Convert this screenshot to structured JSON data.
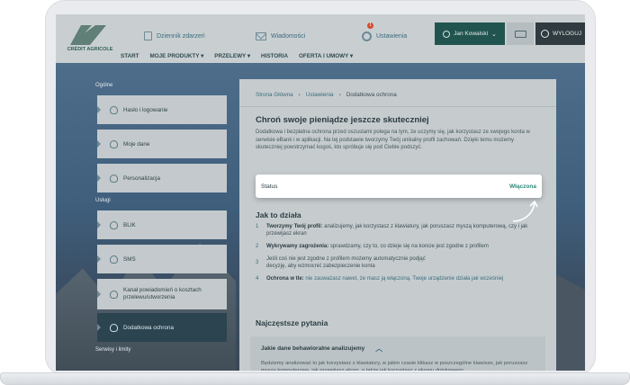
{
  "header": {
    "logo_text": "CRÉDIT AGRICOLE",
    "links": {
      "history": "Dziennik zdarzeń",
      "messages": "Wiadomości",
      "settings": "Ustawienia"
    },
    "notification_count": "1",
    "user_name": "Jan Kowalski",
    "logout_label": "WYLOGUJ",
    "nav": [
      "START",
      "MOJE PRODUKTY ▾",
      "PRZELEWY ▾",
      "HISTORIA",
      "OFERTA I UMOWY ▾"
    ]
  },
  "sidebar": {
    "section_general": "Ogólne",
    "section_services": "Usługi",
    "section_other": "Serwisy i limity",
    "items": [
      {
        "label": "Hasło i logowanie"
      },
      {
        "label": "Moje dane"
      },
      {
        "label": "Personalizacja"
      },
      {
        "label": "BLIK"
      },
      {
        "label": "SMS"
      },
      {
        "label": "Kanał powiadomień o kosztach przelewu/utworzenia"
      },
      {
        "label": "Dodatkowa ochrona"
      }
    ]
  },
  "main": {
    "breadcrumb": [
      "Strona Główna",
      "Ustawienia",
      "Dodatkowa ochrona"
    ],
    "title": "Chroń swoje pieniądze jeszcze skuteczniej",
    "lead": "Dodatkowa i bezpłatna ochrona przed oszustami polega na tym, że uczymy się, jak korzystasz ze swojego konta w serwisie eBank i w aplikacji. Na tej podstawie tworzymy Twój unikalny profil zachowań. Dzięki temu możemy skuteczniej powstrzymać kogoś, kto spróbuje się pod Ciebie podszyć.",
    "status_label": "Status",
    "status_value": "Włączona",
    "how_title": "Jak to działa",
    "steps": [
      {
        "num": "1",
        "bold": "Tworzymy Twój profil:",
        "text": " analizujemy, jak korzystasz z klawiatury, jak poruszasz myszą komputerową, czy i jak przewijasz ekran"
      },
      {
        "num": "2",
        "bold": "Wykrywamy zagrożenia:",
        "text": " sprawdzamy, czy to, co dzieje się na koncie jest zgodne z profilem"
      },
      {
        "num": "3",
        "bold": "",
        "text": "Jeśli coś nie jest zgodne z profilem możemy automatycznie podjąć decyzję, aby wzmocnić zabezpieczenie konta"
      },
      {
        "num": "4",
        "bold": "Ochrona w tle:",
        "text": " nie zauważasz nawet, że masz ją włączoną. Twoje urządzenie działa jak wcześniej"
      }
    ],
    "faq_title": "Najczęstsze pytania",
    "faq_question": "Jakie dane behawioralne analizujemy",
    "faq_answer": "Będziemy analizować to jak korzystasz z klawiatury, w jakim czasie klikasz w poszczególne klawisze, jak poruszasz myszą komputerową, jak przewijasz ekran, a także jak korzystasz z ekranu dotykowego."
  }
}
